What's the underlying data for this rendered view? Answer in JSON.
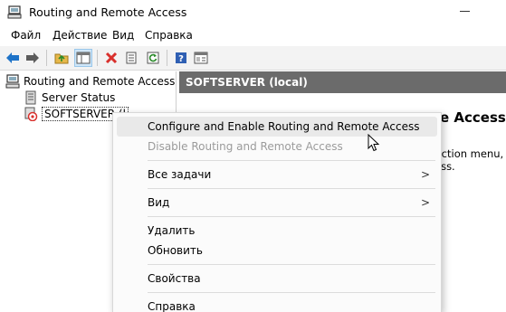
{
  "window": {
    "title": "Routing and Remote Access",
    "app_icon": "server-icon",
    "minimize_icon": "minimize-icon"
  },
  "menubar": {
    "items": [
      "Файл",
      "Действие",
      "Вид",
      "Справка"
    ]
  },
  "toolbar": {
    "buttons": [
      "back-arrow-icon",
      "forward-arrow-icon",
      "up-folder-icon",
      "show-hide-tree-icon",
      "delete-icon",
      "properties-icon",
      "refresh-icon",
      "help-icon",
      "console-view-icon"
    ]
  },
  "tree": {
    "root": {
      "label": "Routing and Remote Access",
      "icon": "server-icon"
    },
    "items": [
      {
        "label": "Server Status",
        "icon": "server-status-icon"
      },
      {
        "label": "SOFTSERVER (l",
        "icon": "server-stopped-icon"
      }
    ]
  },
  "rightpane": {
    "header": "SOFTSERVER (local)",
    "heading": "e Access",
    "text_line1": "Action menu,",
    "text_line2": "ess."
  },
  "context_menu": {
    "items": [
      {
        "label": "Configure and Enable Routing and Remote Access",
        "disabled": false,
        "submenu": false
      },
      {
        "label": "Disable Routing and Remote Access",
        "disabled": true,
        "submenu": false
      },
      {
        "label": "Все задачи",
        "disabled": false,
        "submenu": true
      },
      {
        "label": "Вид",
        "disabled": false,
        "submenu": true
      },
      {
        "label": "Удалить",
        "disabled": false,
        "submenu": false
      },
      {
        "label": "Обновить",
        "disabled": false,
        "submenu": false
      },
      {
        "label": "Свойства",
        "disabled": false,
        "submenu": false
      },
      {
        "label": "Справка",
        "disabled": false,
        "submenu": false
      }
    ],
    "submenu_arrow": ">"
  },
  "colors": {
    "header_bg": "#6b6b6b",
    "accent": "#0078d7",
    "delete_red": "#d9302c"
  }
}
